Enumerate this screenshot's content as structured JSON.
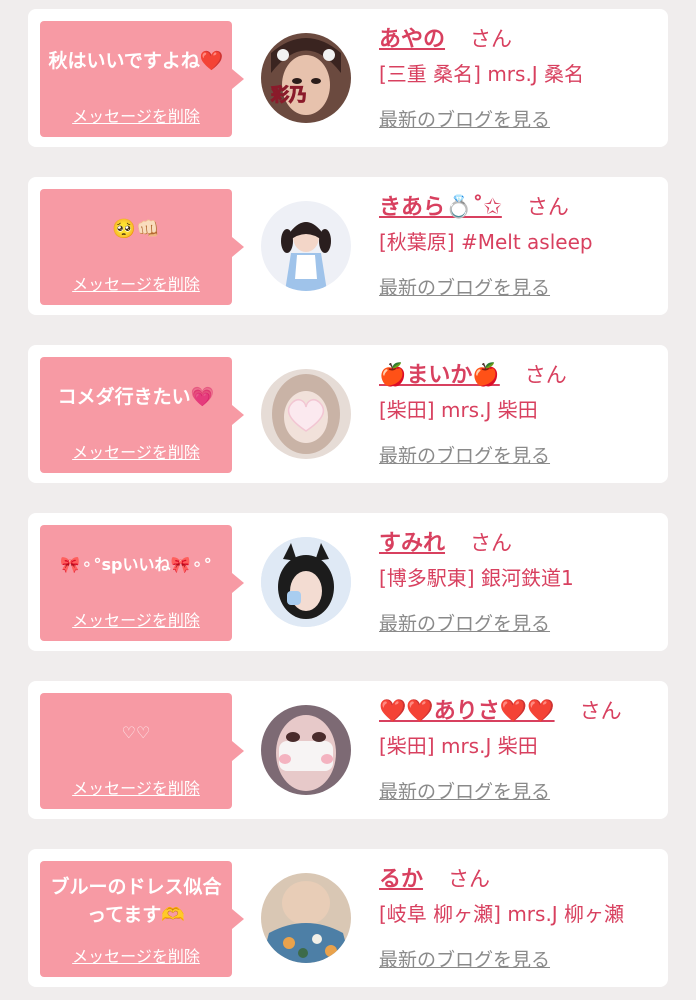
{
  "cards": [
    {
      "message": "秋はいいですよね❤️",
      "delete_label": "メッセージを削除",
      "name": "あやの",
      "honorific": "さん",
      "shop": "[三重 桑名] mrs.J 桑名",
      "blog_label": "最新のブログを見る",
      "avatar_text": "彩乃"
    },
    {
      "message": "🥺👊🏻",
      "delete_label": "メッセージを削除",
      "name": "きあら💍˚✩",
      "honorific": "さん",
      "shop": "[秋葉原] #Melt asleep",
      "blog_label": "最新のブログを見る"
    },
    {
      "message": "コメダ行きたい💗",
      "delete_label": "メッセージを削除",
      "name": "🍎まいか🍎",
      "honorific": "さん",
      "shop": "[柴田] mrs.J 柴田",
      "blog_label": "最新のブログを見る"
    },
    {
      "message": "🎀⚬°spいいね🎀⚬°",
      "delete_label": "メッセージを削除",
      "name": "すみれ",
      "honorific": "さん",
      "shop": "[博多駅東] 銀河鉄道1",
      "blog_label": "最新のブログを見る"
    },
    {
      "message": "♡♡",
      "delete_label": "メッセージを削除",
      "name": "❤️❤️ありさ❤️❤️",
      "honorific": "さん",
      "shop": "[柴田] mrs.J 柴田",
      "blog_label": "最新のブログを見る"
    },
    {
      "message": "ブルーのドレス似合ってます🫶",
      "delete_label": "メッセージを削除",
      "name": "るか",
      "honorific": "さん",
      "shop": "[岐阜 柳ヶ瀬] mrs.J 柳ヶ瀬",
      "blog_label": "最新のブログを見る"
    }
  ],
  "colors": {
    "page_background": "#f0eded",
    "card_background": "#ffffff",
    "bubble": "#f79aa4",
    "accent_text": "#d8405f",
    "link_gray": "#8a8a8a"
  },
  "icons": {
    "avatar": "profile-photo"
  }
}
